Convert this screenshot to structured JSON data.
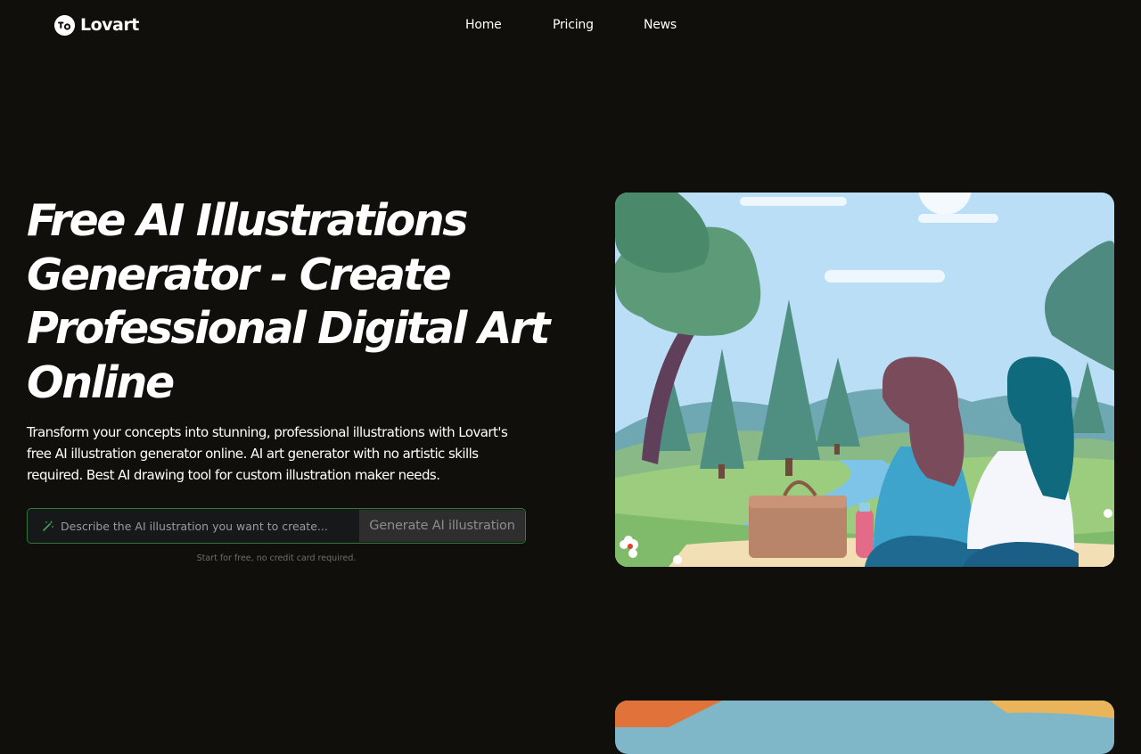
{
  "header": {
    "brand": "Lovart",
    "nav": [
      {
        "label": "Home"
      },
      {
        "label": "Pricing"
      },
      {
        "label": "News"
      }
    ]
  },
  "hero": {
    "title": "Free AI Illustrations Generator - Create Professional Digital Art Online",
    "description": "Transform your concepts into stunning, professional illustrations with Lovart's free AI illustration generator online. AI art generator with no artistic skills required. Best AI drawing tool for custom illustration maker needs.",
    "prompt": {
      "placeholder": "Describe the AI illustration you want to create...",
      "value": "",
      "icon": "magic-wand-icon"
    },
    "generate_label": "Generate AI illustration",
    "note": "Start for free, no credit card required."
  },
  "colors": {
    "background": "#110f0c",
    "input_border": "#2f7a3b",
    "button_bg": "#2e2e2e",
    "text": "#ffffff"
  }
}
